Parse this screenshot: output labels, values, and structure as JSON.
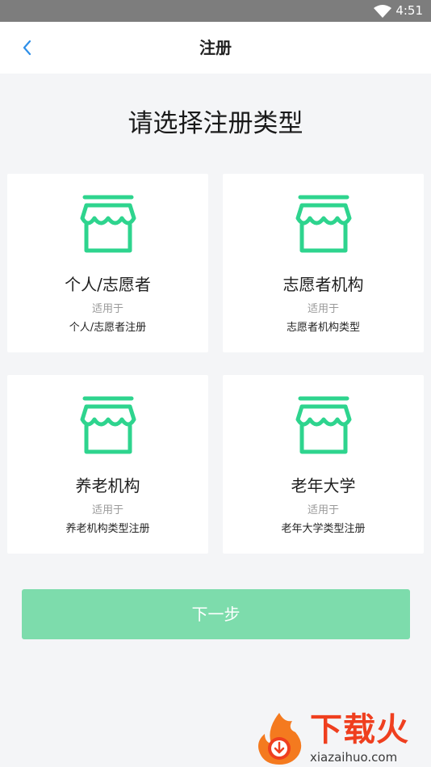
{
  "status_bar": {
    "time": "4:51"
  },
  "navbar": {
    "title": "注册",
    "back_icon": "chevron-left-icon",
    "accent": "#2e8fe8"
  },
  "heading": "请选择注册类型",
  "types": [
    {
      "icon": "storefront-icon",
      "name": "个人/志愿者",
      "caption": "适用于",
      "description": "个人/志愿者注册"
    },
    {
      "icon": "storefront-icon",
      "name": "志愿者机构",
      "caption": "适用于",
      "description": "志愿者机构类型"
    },
    {
      "icon": "storefront-icon",
      "name": "养老机构",
      "caption": "适用于",
      "description": "养老机构类型注册"
    },
    {
      "icon": "storefront-icon",
      "name": "老年大学",
      "caption": "适用于",
      "description": "老年大学类型注册"
    }
  ],
  "next_button": {
    "label": "下一步",
    "color": "#7ddcac"
  },
  "watermark": {
    "brand": "下载火",
    "site": "xiazaihuo.com"
  },
  "colors": {
    "icon_green": "#2ed48e",
    "background": "#f4f5f7"
  }
}
